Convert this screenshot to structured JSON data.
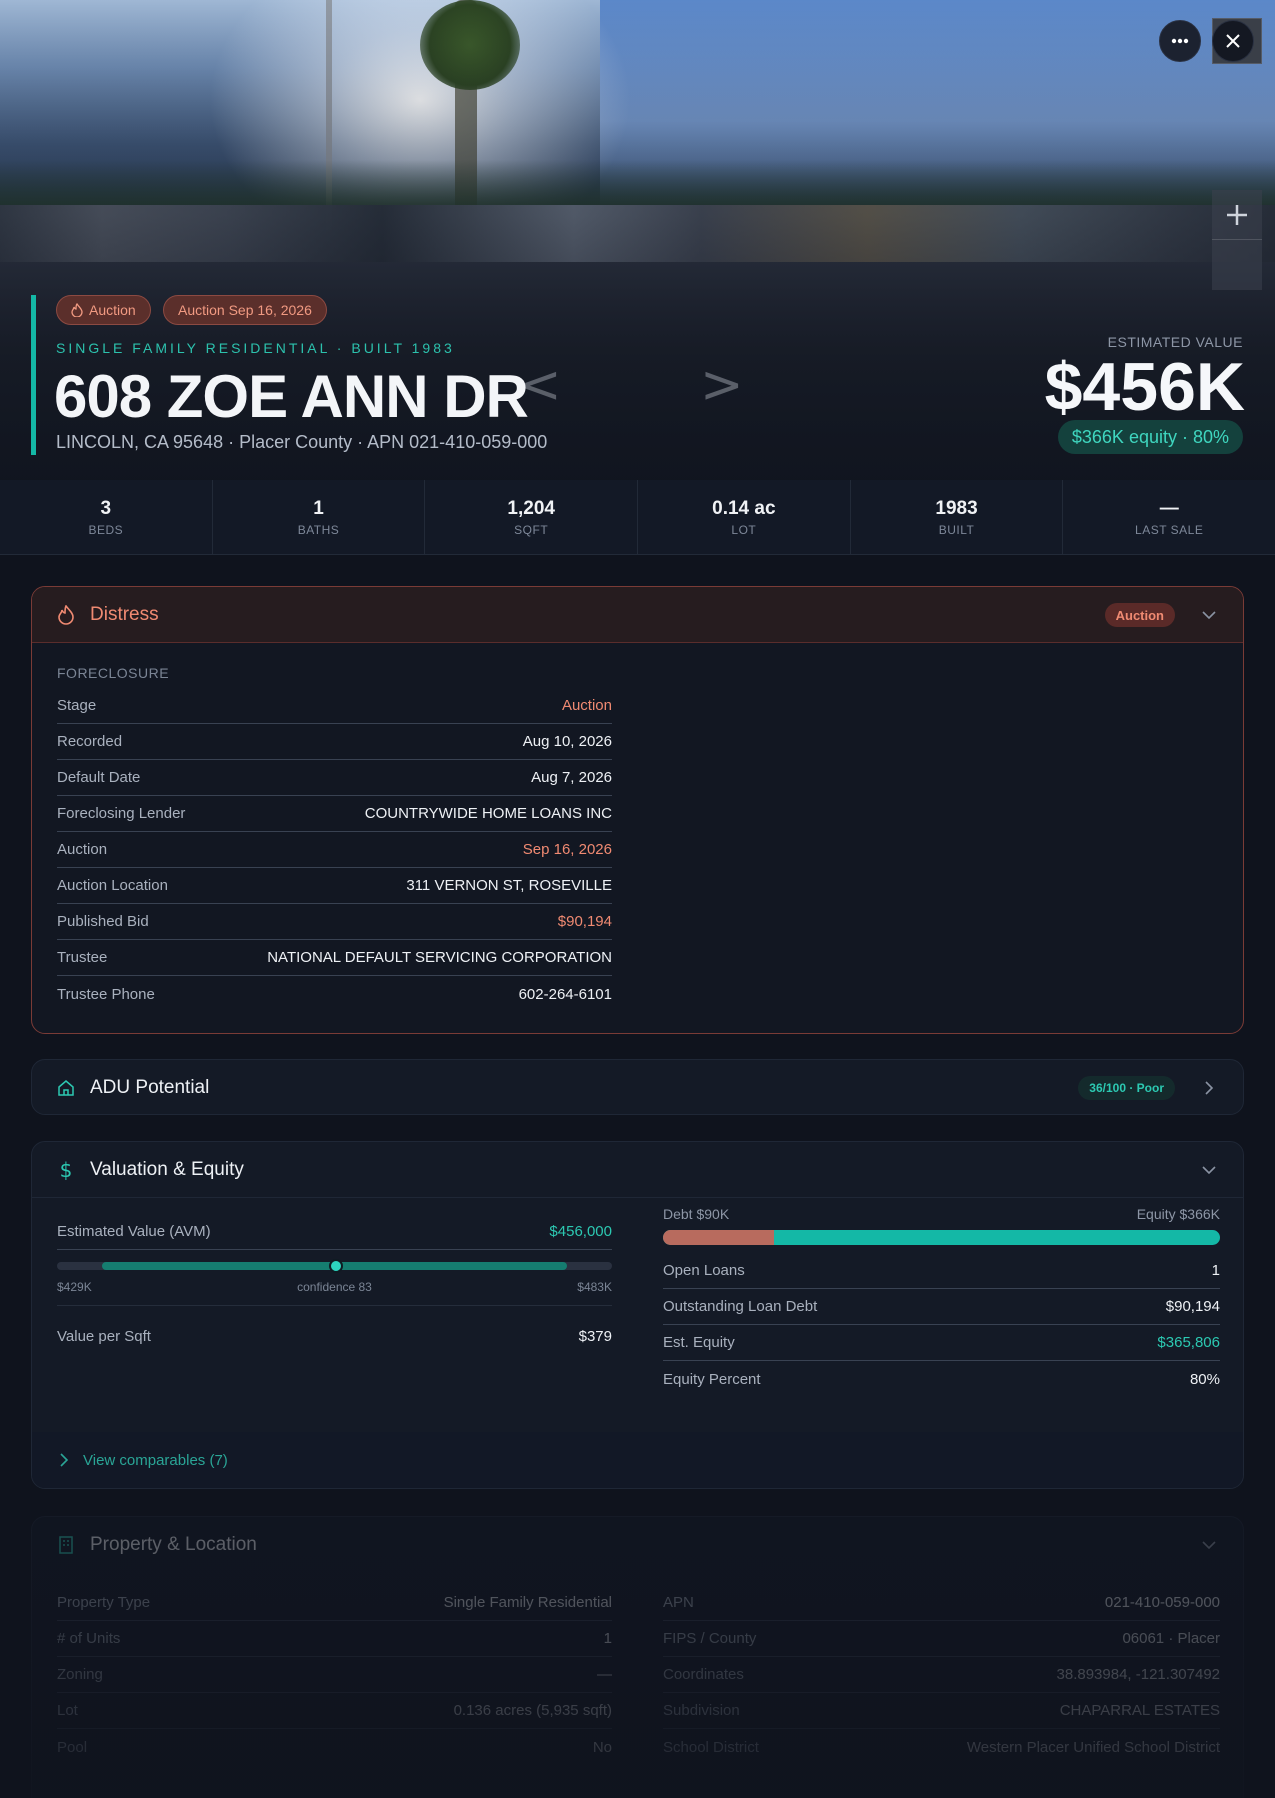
{
  "hero": {
    "badges": [
      {
        "icon": "flame-icon",
        "label": "Auction"
      },
      {
        "label": "Auction Sep 16, 2026"
      }
    ],
    "subtitle": "SINGLE FAMILY RESIDENTIAL · BUILT 1983",
    "address": "608 ZOE ANN DR",
    "location": "LINCOLN, CA 95648 · Placer County · APN 021-410-059-000",
    "estimated_label": "ESTIMATED VALUE",
    "estimated_value": "$456K",
    "equity_pill": "$366K equity · 80%",
    "more_icon": "ellipsis-icon",
    "close_icon": "close-icon",
    "zoom_in_icon": "plus-icon",
    "prev_icon": "<",
    "next_icon": ">"
  },
  "stats": [
    {
      "value": "3",
      "label": "BEDS"
    },
    {
      "value": "1",
      "label": "BATHS"
    },
    {
      "value": "1,204",
      "label": "SQFT"
    },
    {
      "value": "0.14 ac",
      "label": "LOT"
    },
    {
      "value": "1983",
      "label": "BUILT"
    },
    {
      "value": "—",
      "label": "LAST SALE"
    }
  ],
  "distress": {
    "title": "Distress",
    "badge": "Auction",
    "section": "FORECLOSURE",
    "rows": [
      {
        "k": "Stage",
        "v": "Auction",
        "accent": "red"
      },
      {
        "k": "Recorded",
        "v": "Aug 10, 2026"
      },
      {
        "k": "Default Date",
        "v": "Aug 7, 2026"
      },
      {
        "k": "Foreclosing Lender",
        "v": "COUNTRYWIDE HOME LOANS INC"
      },
      {
        "k": "Auction",
        "v": "Sep 16, 2026",
        "accent": "red"
      },
      {
        "k": "Auction Location",
        "v": "311 VERNON ST, ROSEVILLE"
      },
      {
        "k": "Published Bid",
        "v": "$90,194",
        "accent": "red"
      },
      {
        "k": "Trustee",
        "v": "NATIONAL DEFAULT SERVICING CORPORATION"
      },
      {
        "k": "Trustee Phone",
        "v": "602-264-6101"
      }
    ]
  },
  "adu": {
    "title": "ADU Potential",
    "badge": "36/100 · Poor"
  },
  "valuation": {
    "title": "Valuation & Equity",
    "avm_label": "Estimated Value (AVM)",
    "avm_value": "$456,000",
    "range_low": "$429K",
    "range_mid": "confidence 83",
    "range_high": "$483K",
    "per_sqft_label": "Value per Sqft",
    "per_sqft_value": "$379",
    "debt_label": "Debt $90K",
    "equity_label": "Equity $366K",
    "debt_fraction": 0.2,
    "rows": [
      {
        "k": "Open Loans",
        "v": "1"
      },
      {
        "k": "Outstanding Loan Debt",
        "v": "$90,194"
      },
      {
        "k": "Est. Equity",
        "v": "$365,806",
        "accent": "teal"
      },
      {
        "k": "Equity Percent",
        "v": "80%"
      }
    ],
    "comps_link": "View comparables (7)"
  },
  "property": {
    "title": "Property & Location",
    "left": [
      {
        "k": "Property Type",
        "v": "Single Family Residential"
      },
      {
        "k": "# of Units",
        "v": "1"
      },
      {
        "k": "Zoning",
        "v": "—"
      },
      {
        "k": "Lot",
        "v": "0.136 acres (5,935 sqft)"
      },
      {
        "k": "Pool",
        "v": "No"
      }
    ],
    "right": [
      {
        "k": "APN",
        "v": "021-410-059-000"
      },
      {
        "k": "FIPS / County",
        "v": "06061 · Placer"
      },
      {
        "k": "Coordinates",
        "v": "38.893984, -121.307492"
      },
      {
        "k": "Subdivision",
        "v": "CHAPARRAL ESTATES"
      },
      {
        "k": "School District",
        "v": "Western Placer Unified School District"
      }
    ]
  },
  "colors": {
    "accent": "#14b8a6",
    "danger": "#f08a72",
    "background": "#0f131d"
  }
}
